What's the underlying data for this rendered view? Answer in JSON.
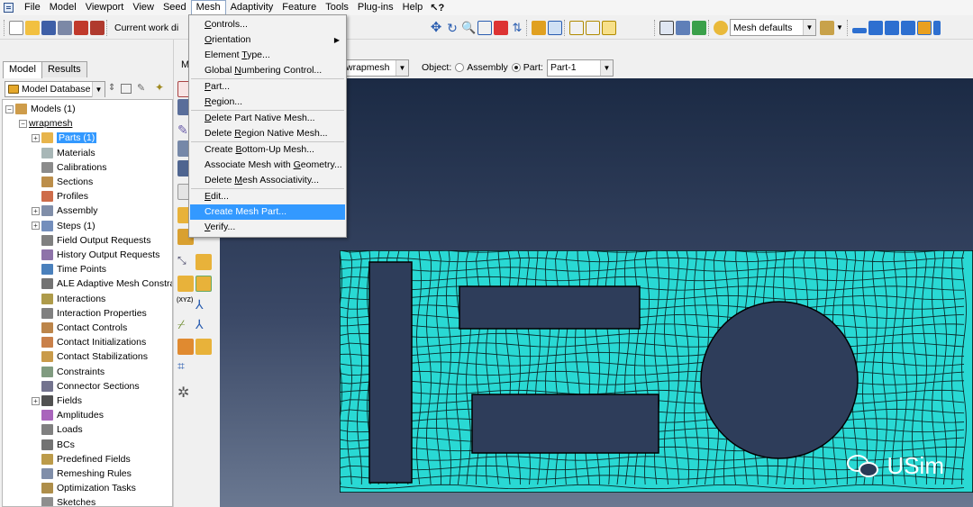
{
  "menubar": {
    "items": [
      "File",
      "Model",
      "Viewport",
      "View",
      "Seed",
      "Mesh",
      "Adaptivity",
      "Feature",
      "Tools",
      "Plug-ins",
      "Help"
    ],
    "active": "Mesh",
    "help_cursor": "↖?"
  },
  "toolbar": {
    "current_work_dir_label": "Current work di",
    "mesh_defaults": "Mesh defaults"
  },
  "leftpanel": {
    "tabs": [
      "Model",
      "Results"
    ],
    "selected_tab": "Model",
    "model_database": "Model Database",
    "tree": [
      {
        "label": "Models (1)",
        "level": 0,
        "expander": "-",
        "icon": "models"
      },
      {
        "label": "wrapmesh",
        "level": 1,
        "expander": "-",
        "icon": "none",
        "underline": true
      },
      {
        "label": "Parts (1)",
        "level": 2,
        "expander": "+",
        "icon": "parts",
        "selected": true
      },
      {
        "label": "Materials",
        "level": 2,
        "expander": "",
        "icon": "materials"
      },
      {
        "label": "Calibrations",
        "level": 2,
        "expander": "",
        "icon": "calibrations"
      },
      {
        "label": "Sections",
        "level": 2,
        "expander": "",
        "icon": "sections"
      },
      {
        "label": "Profiles",
        "level": 2,
        "expander": "",
        "icon": "profiles"
      },
      {
        "label": "Assembly",
        "level": 2,
        "expander": "+",
        "icon": "assembly"
      },
      {
        "label": "Steps (1)",
        "level": 2,
        "expander": "+",
        "icon": "steps"
      },
      {
        "label": "Field Output Requests",
        "level": 2,
        "expander": "",
        "icon": "field-output"
      },
      {
        "label": "History Output Requests",
        "level": 2,
        "expander": "",
        "icon": "history-output"
      },
      {
        "label": "Time Points",
        "level": 2,
        "expander": "",
        "icon": "time-points"
      },
      {
        "label": "ALE Adaptive Mesh Constrai",
        "level": 2,
        "expander": "",
        "icon": "ale"
      },
      {
        "label": "Interactions",
        "level": 2,
        "expander": "",
        "icon": "interactions"
      },
      {
        "label": "Interaction Properties",
        "level": 2,
        "expander": "",
        "icon": "interaction-properties"
      },
      {
        "label": "Contact Controls",
        "level": 2,
        "expander": "",
        "icon": "contact-controls"
      },
      {
        "label": "Contact Initializations",
        "level": 2,
        "expander": "",
        "icon": "contact-init"
      },
      {
        "label": "Contact Stabilizations",
        "level": 2,
        "expander": "",
        "icon": "contact-stab"
      },
      {
        "label": "Constraints",
        "level": 2,
        "expander": "",
        "icon": "constraints"
      },
      {
        "label": "Connector Sections",
        "level": 2,
        "expander": "",
        "icon": "connector-sections"
      },
      {
        "label": "Fields",
        "level": 2,
        "expander": "+",
        "icon": "fields"
      },
      {
        "label": "Amplitudes",
        "level": 2,
        "expander": "",
        "icon": "amplitudes"
      },
      {
        "label": "Loads",
        "level": 2,
        "expander": "",
        "icon": "loads"
      },
      {
        "label": "BCs",
        "level": 2,
        "expander": "",
        "icon": "bcs"
      },
      {
        "label": "Predefined Fields",
        "level": 2,
        "expander": "",
        "icon": "predefined-fields"
      },
      {
        "label": "Remeshing Rules",
        "level": 2,
        "expander": "",
        "icon": "remeshing-rules"
      },
      {
        "label": "Optimization Tasks",
        "level": 2,
        "expander": "",
        "icon": "optimization"
      },
      {
        "label": "Sketches",
        "level": 2,
        "expander": "",
        "icon": "sketches"
      }
    ]
  },
  "context": {
    "module_prefix": "M",
    "model_value": "wrapmesh",
    "object_label": "Object:",
    "assembly_label": "Assembly",
    "part_label": "Part:",
    "part_value": "Part-1",
    "object_selected": "Part"
  },
  "dropdown": {
    "items": [
      {
        "label": "Controls...",
        "u": "C"
      },
      {
        "label": "Orientation",
        "u": "O",
        "submenu": true
      },
      {
        "label": "Element Type...",
        "u": "T"
      },
      {
        "label": "Global Numbering Control...",
        "u": "N"
      },
      {
        "sep": true
      },
      {
        "label": "Part...",
        "u": "P"
      },
      {
        "label": "Region...",
        "u": "R"
      },
      {
        "sep": true
      },
      {
        "label": "Delete Part Native Mesh...",
        "u": "D"
      },
      {
        "label": "Delete Region Native Mesh...",
        "u": "R"
      },
      {
        "sep": true
      },
      {
        "label": "Create Bottom-Up Mesh...",
        "u": "B"
      },
      {
        "label": "Associate Mesh with Geometry...",
        "u": "G"
      },
      {
        "label": "Delete Mesh Associativity...",
        "u": "M"
      },
      {
        "sep": true
      },
      {
        "label": "Edit...",
        "u": "E"
      },
      {
        "label": "Create Mesh Part...",
        "u": "",
        "highlighted": true
      },
      {
        "label": "Verify...",
        "u": "V"
      }
    ]
  },
  "viewport": {
    "mesh_color": "#29d9d4",
    "watermark": "USim"
  },
  "colors": {
    "highlight": "#3399ff",
    "viewport_top": "#1b2a44",
    "viewport_bottom": "#6a7891"
  }
}
